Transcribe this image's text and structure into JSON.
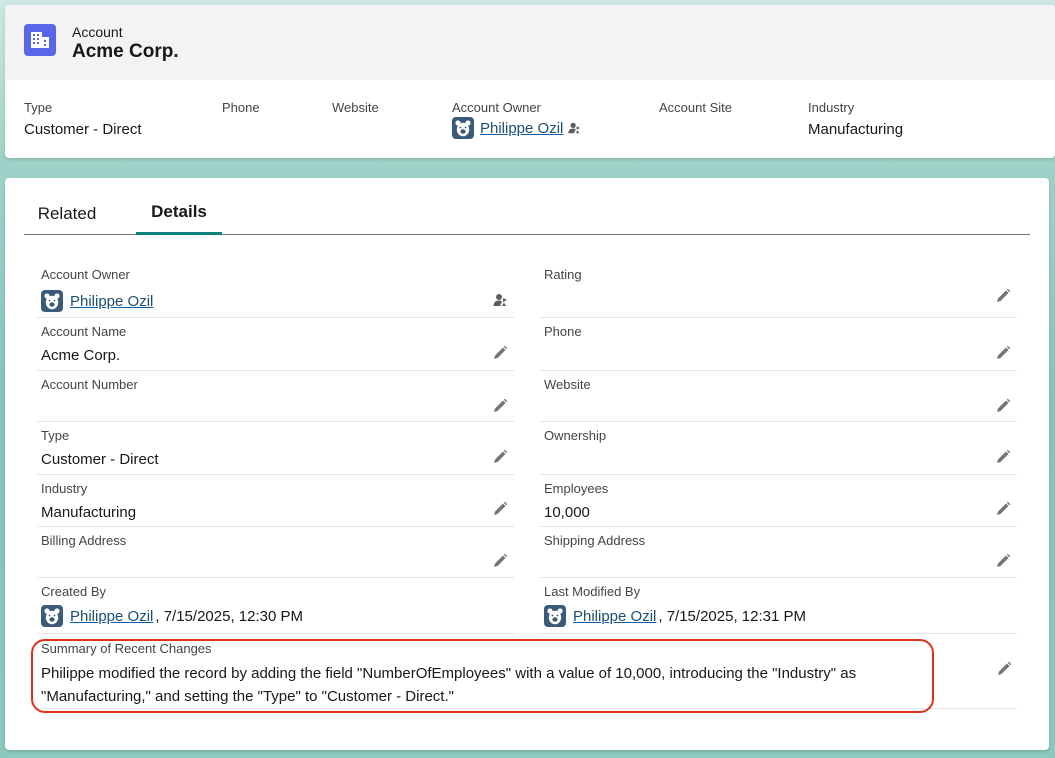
{
  "header": {
    "object_label": "Account",
    "record_title": "Acme Corp.",
    "icon": "account-building-icon",
    "highlights": [
      {
        "label": "Type",
        "value": "Customer - Direct"
      },
      {
        "label": "Phone",
        "value": ""
      },
      {
        "label": "Website",
        "value": ""
      },
      {
        "label": "Account Owner",
        "value": "Philippe Ozil"
      },
      {
        "label": "Account Site",
        "value": ""
      },
      {
        "label": "Industry",
        "value": "Manufacturing"
      }
    ]
  },
  "tabs": [
    {
      "label": "Related",
      "active": false
    },
    {
      "label": "Details",
      "active": true
    }
  ],
  "details": {
    "left": [
      {
        "label": "Account Owner",
        "value": "Philippe Ozil"
      },
      {
        "label": "Account Name",
        "value": "Acme Corp."
      },
      {
        "label": "Account Number",
        "value": ""
      },
      {
        "label": "Type",
        "value": "Customer - Direct"
      },
      {
        "label": "Industry",
        "value": "Manufacturing"
      },
      {
        "label": "Billing Address",
        "value": ""
      },
      {
        "label": "Created By",
        "user": "Philippe Ozil",
        "date": ", 7/15/2025, 12:30 PM"
      }
    ],
    "right": [
      {
        "label": "Rating",
        "value": ""
      },
      {
        "label": "Phone",
        "value": ""
      },
      {
        "label": "Website",
        "value": ""
      },
      {
        "label": "Ownership",
        "value": ""
      },
      {
        "label": "Employees",
        "value": "10,000"
      },
      {
        "label": "Shipping Address",
        "value": ""
      },
      {
        "label": "Last Modified By",
        "user": "Philippe Ozil",
        "date": ", 7/15/2025, 12:31 PM"
      }
    ],
    "summary": {
      "label": "Summary of Recent Changes",
      "value": "Philippe modified the record by adding the field \"NumberOfEmployees\" with a value of 10,000, introducing the \"Industry\" as \"Manufacturing,\" and setting the \"Type\" to \"Customer - Direct.\""
    }
  },
  "colors": {
    "accent_tab": "#0b827c",
    "icon_bg": "#5867e8",
    "highlight_border": "#e0301e"
  }
}
